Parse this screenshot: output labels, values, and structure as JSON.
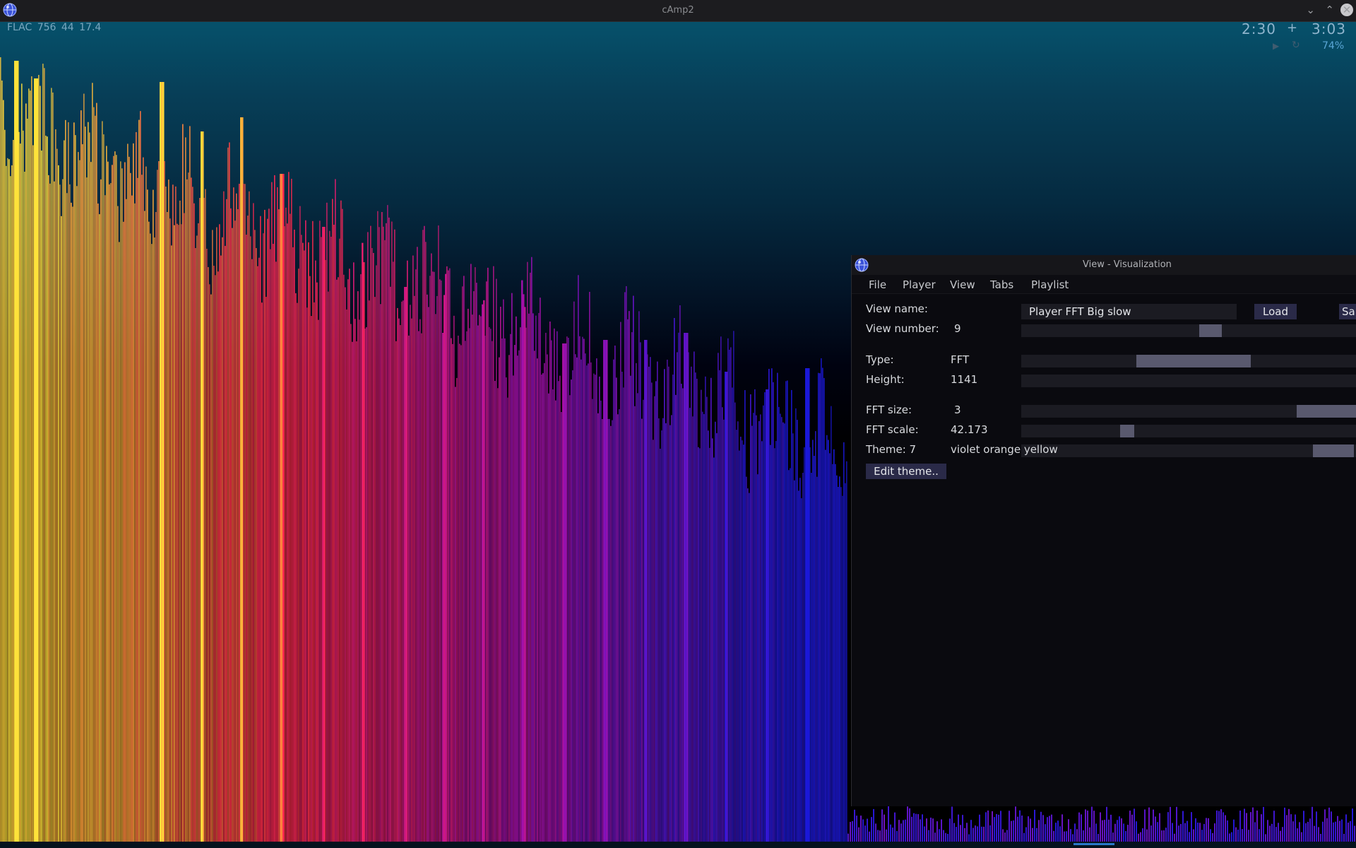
{
  "window": {
    "title": "cAmp2"
  },
  "player": {
    "format_info": "FLAC 756 44  17.4",
    "time_elapsed": "2:30",
    "time_separator": "+",
    "time_total": "3:03",
    "volume": "74%"
  },
  "icons": {
    "app": "globe-icon",
    "minimize": "chevron-down-icon",
    "maximize": "chevron-up-icon",
    "close": "close-icon",
    "play": "play-icon",
    "repeat": "repeat-icon"
  },
  "visualization": {
    "palette": [
      "#ffe23a",
      "#ff9a3a",
      "#ff2a4a",
      "#d81a78",
      "#a010a8",
      "#5a14c8",
      "#1a18d8"
    ],
    "background_top": "#06516b"
  },
  "dialog": {
    "title": "View - Visualization",
    "menu": [
      "File",
      "Player",
      "View",
      "Tabs",
      "Playlist"
    ],
    "view_name_label": "View name:",
    "view_name_value": "Player FFT Big slow",
    "load_button": "Load",
    "save_button": "Sa",
    "view_number_label": "View number:",
    "view_number_value": "9",
    "view_number_level": 0.53,
    "type_label": "Type:",
    "type_value": "FFT",
    "height_label": "Height:",
    "height_value": "1141",
    "fft_size_label": "FFT size:",
    "fft_size_value": "3",
    "fft_scale_label": "FFT scale:",
    "fft_scale_value": "42.173",
    "theme_label": "Theme:  7",
    "theme_value": "violet orange yellow",
    "edit_theme_button": "Edit theme.."
  }
}
